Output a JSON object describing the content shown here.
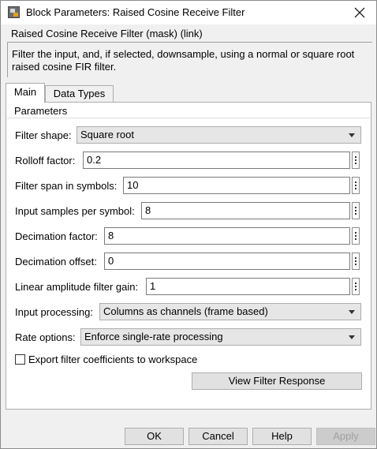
{
  "window": {
    "title": "Block Parameters: Raised Cosine Receive Filter"
  },
  "mask": {
    "title": "Raised Cosine Receive Filter (mask) (link)",
    "description": "Filter the input, and, if selected, downsample, using a normal or square root raised cosine FIR filter."
  },
  "tabs": [
    {
      "label": "Main",
      "selected": true
    },
    {
      "label": "Data Types",
      "selected": false
    }
  ],
  "parameters": {
    "group_label": "Parameters",
    "filter_shape": {
      "label": "Filter shape:",
      "value": "Square root"
    },
    "rolloff_factor": {
      "label": "Rolloff factor:",
      "value": "0.2"
    },
    "filter_span": {
      "label": "Filter span in symbols:",
      "value": "10"
    },
    "samples_per_symbol": {
      "label": "Input samples per symbol:",
      "value": "8"
    },
    "decimation_factor": {
      "label": "Decimation factor:",
      "value": "8"
    },
    "decimation_offset": {
      "label": "Decimation offset:",
      "value": "0"
    },
    "filter_gain": {
      "label": "Linear amplitude filter gain:",
      "value": "1"
    },
    "input_processing": {
      "label": "Input processing:",
      "value": "Columns as channels (frame based)"
    },
    "rate_options": {
      "label": "Rate options:",
      "value": "Enforce single-rate processing"
    },
    "export_coefficients": {
      "label": "Export filter coefficients to workspace",
      "checked": false
    },
    "view_response_label": "View Filter Response"
  },
  "buttons": {
    "ok": "OK",
    "cancel": "Cancel",
    "help": "Help",
    "apply": "Apply"
  },
  "icons": {
    "app": "simulink-block-icon",
    "close": "close-icon",
    "more": "more-options-icon",
    "dropdown": "chevron-down-icon"
  }
}
